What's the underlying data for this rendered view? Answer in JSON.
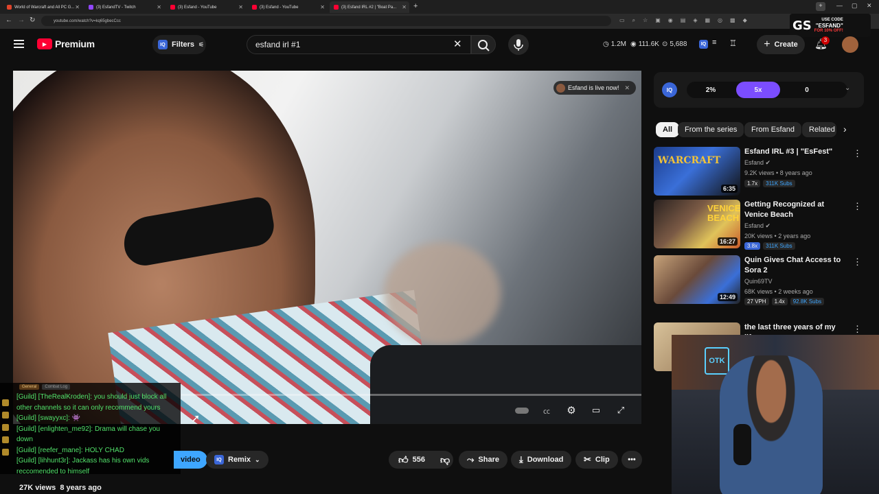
{
  "browser": {
    "tabs": [
      {
        "label": "World of Warcraft and All PC G...",
        "color": "#e0442b"
      },
      {
        "label": "(3) EsfandTV - Twitch",
        "color": "#9146ff"
      },
      {
        "label": "(3) Esfand - YouTube",
        "color": "#ff0033"
      },
      {
        "label": "(3) Esfand - YouTube",
        "color": "#ff0033"
      },
      {
        "label": "(3) Esfand IRL #2 | \"Boat Pa...",
        "color": "#ff0033"
      }
    ],
    "url": "youtube.com/watch?v=kq65gbecCcc"
  },
  "promo": {
    "logo": "GS",
    "line1": "USE CODE",
    "line2": "\"ESFAND\"",
    "line3": "FOR 10% OFF!"
  },
  "header": {
    "brand": "Premium",
    "filters_label": "Filters",
    "search_value": "esfand irl #1",
    "stats": {
      "subs": "1.2M",
      "views": "111.6K",
      "viewers": "5,688"
    },
    "create_label": "Create",
    "notif_count": "3"
  },
  "video": {
    "live_badge": "Esfand is live now!"
  },
  "chat": {
    "tabs": [
      "General",
      "Combat Log"
    ],
    "lines": [
      "[Guild] [TheRealKroden]: you should just block all other channels so it can only recommend yours",
      "[Guild] [swayyxc]: 👾",
      "[Guild] [enlighten_me92]: Drama will chase you down",
      "[Guild] [reefer_mane]: HOLY CHAD",
      "[Guild] [lihhunt3r]: Jackass has his own vids reccomended to himself"
    ]
  },
  "actions": {
    "video_label": "video",
    "remix_label": "Remix",
    "likes": "556",
    "share_label": "Share",
    "download_label": "Download",
    "clip_label": "Clip"
  },
  "meta": {
    "views": "27K views",
    "age": "8 years ago"
  },
  "sidebar": {
    "iq": {
      "percent": "2%",
      "multiplier": "5x",
      "count": "0"
    },
    "chips": [
      "All",
      "From the series",
      "From Esfand",
      "Related"
    ],
    "recs": [
      {
        "title": "Esfand IRL #3 | \"EsFest\"",
        "channel": "Esfand",
        "views": "9.2K views",
        "age": "8 years ago",
        "duration": "6:35",
        "badges": [
          "1.7x",
          "311K Subs"
        ]
      },
      {
        "title": "Getting Recognized at Venice Beach",
        "channel": "Esfand",
        "views": "20K views",
        "age": "2 years ago",
        "duration": "16:27",
        "badges": [
          "3.8x",
          "311K Subs"
        ]
      },
      {
        "title": "Quin Gives Chat Access to Sora 2",
        "channel": "Quin69TV",
        "views": "68K views",
        "age": "2 weeks ago",
        "duration": "12:49",
        "badges": [
          "27 VPH",
          "1.4x",
          "92.8K Subs"
        ]
      },
      {
        "title": "the last three years of my life",
        "channel": "",
        "views": "",
        "age": "",
        "duration": "",
        "badges": []
      }
    ]
  },
  "colors": {
    "accent": "#ff0033",
    "iq_blue": "#3a66d8",
    "iq_purple": "#7b4dff",
    "chat_green": "#52e36b"
  }
}
